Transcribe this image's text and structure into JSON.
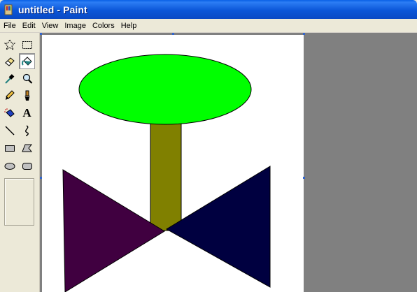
{
  "window": {
    "title": "untitled - Paint",
    "app_icon": "paint-app-icon"
  },
  "menu": [
    "File",
    "Edit",
    "View",
    "Image",
    "Colors",
    "Help"
  ],
  "toolbox": {
    "tools": [
      {
        "name": "free-form-select",
        "icon": "free-form-select-icon"
      },
      {
        "name": "rectangle-select",
        "icon": "rectangle-select-icon"
      },
      {
        "name": "eraser",
        "icon": "eraser-icon"
      },
      {
        "name": "fill-with-color",
        "icon": "fill-bucket-icon",
        "selected": true
      },
      {
        "name": "pick-color",
        "icon": "eyedropper-icon"
      },
      {
        "name": "magnifier",
        "icon": "magnifier-icon"
      },
      {
        "name": "pencil",
        "icon": "pencil-icon"
      },
      {
        "name": "brush",
        "icon": "brush-icon"
      },
      {
        "name": "airbrush",
        "icon": "airbrush-icon"
      },
      {
        "name": "text",
        "icon": "text-tool-icon"
      },
      {
        "name": "line",
        "icon": "line-icon"
      },
      {
        "name": "curve",
        "icon": "curve-icon"
      },
      {
        "name": "rectangle",
        "icon": "rectangle-icon"
      },
      {
        "name": "polygon",
        "icon": "polygon-icon"
      },
      {
        "name": "ellipse",
        "icon": "ellipse-icon"
      },
      {
        "name": "rounded-rectangle",
        "icon": "rounded-rectangle-icon"
      }
    ],
    "text_tool_glyph": "A"
  },
  "drawing": {
    "shapes": [
      {
        "name": "tree-canopy-ellipse",
        "fill": "#00ff00"
      },
      {
        "name": "tree-trunk-rectangle",
        "fill": "#808000"
      },
      {
        "name": "left-triangle",
        "fill": "#400040"
      },
      {
        "name": "right-triangle",
        "fill": "#000040"
      }
    ],
    "outline_color": "#000000",
    "canvas_color": "#ffffff"
  },
  "colors": {
    "titlebar": "#0a56d8",
    "workspace": "#808080",
    "chrome": "#ece9d8"
  }
}
